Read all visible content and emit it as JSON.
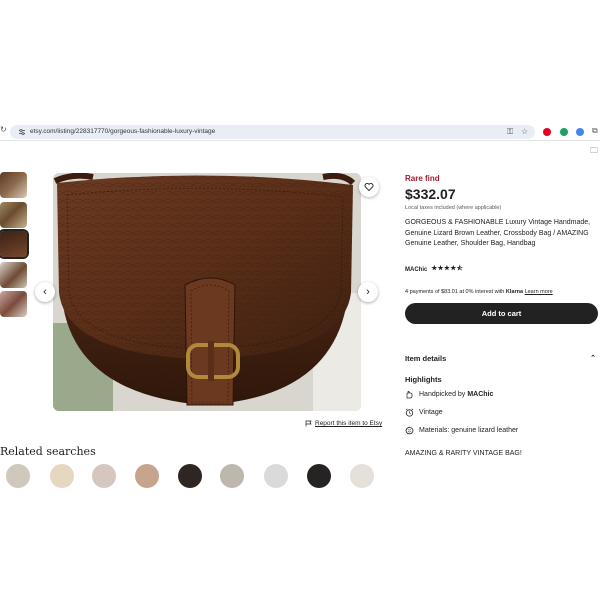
{
  "browser": {
    "url": "etsy.com/listing/228317770/gorgeous-fashionable-luxury-vintage"
  },
  "gallery": {
    "thumbnail_count": 5,
    "active_index": 3
  },
  "report_link": "Report this item to Etsy",
  "related": {
    "title": "Related searches"
  },
  "product": {
    "badge": "Rare find",
    "price": "$332.07",
    "tax_note": "Local taxes included (where applicable)",
    "title": "GORGEOUS & FASHIONABLE Luxury Vintage Handmade, Genuine Lizard Brown Leather, Crossbody Bag / AMAZING Genuine Leather, Shoulder Bag, Handbag",
    "shop_name": "MAChic",
    "rating": 4.5,
    "stars": "★★★★⯪",
    "installments_text": "4 payments of $83.01 at 0% interest with",
    "installments_provider": "Klarna",
    "learn_more": "Learn more",
    "add_to_cart": "Add to cart"
  },
  "details": {
    "section_title": "Item details",
    "highlights_title": "Highlights",
    "handpicked_prefix": "Handpicked by",
    "handpicked_shop": "MAChic",
    "vintage": "Vintage",
    "materials": "Materials: genuine lizard leather",
    "description": "AMAZING & RARITY VINTAGE BAG!"
  },
  "colors": {
    "badge_red": "#a61a2e",
    "button_dark": "#222222",
    "url_bar": "#e9eef6"
  }
}
